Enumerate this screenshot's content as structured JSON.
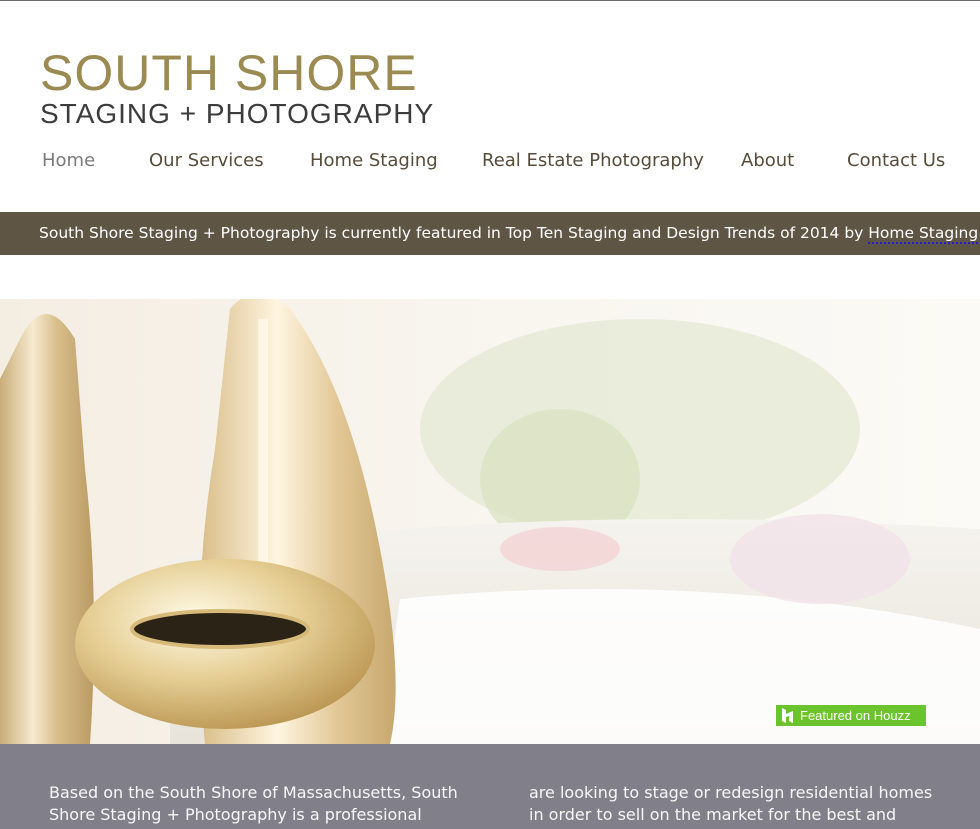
{
  "logo": {
    "line1": "SOUTH SHORE",
    "line2": "STAGING + PHOTOGRAPHY"
  },
  "nav": {
    "items": [
      "Home",
      "Our Services",
      "Home Staging",
      "Real Estate Photography",
      "About",
      "Contact Us"
    ],
    "active": "Home"
  },
  "banner": {
    "text": "South Shore Staging + Photography is currently featured in Top Ten Staging and Design Trends of 2014 by ",
    "link": "Home Staging Resource",
    "end": "."
  },
  "houzz": {
    "label": "Featured on Houzz"
  },
  "info": {
    "col1": "Based on the South Shore of Massachusetts, South Shore Staging + Photography is a professional home",
    "col2": "are looking to stage or redesign residential homes in order to sell on the market for the best and"
  },
  "colors": {
    "banner_bg": "#5f5545",
    "logo_gold": "#9b8a52",
    "nav_text": "#574b3a",
    "houzz_green": "#6cc42c",
    "info_bg": "#81808a"
  }
}
